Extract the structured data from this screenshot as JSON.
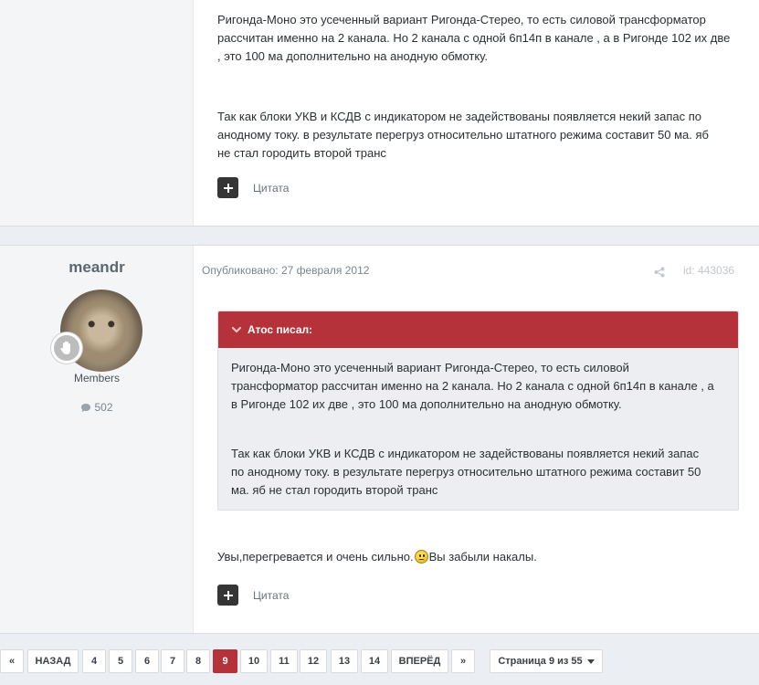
{
  "post1": {
    "paragraph1": "Ригонда-Моно это усеченный вариант Ригонда-Стерео, то есть силовой трансформатор\nрассчитан именно на 2 канала. Но 2 канала с одной 6п14п в канале , а в Ригонде 102 их две\n, это 100 ма дополнительно на анодную обмотку.",
    "paragraph2": "Так как блоки УКВ и КСДВ с индикатором не задействованы появляется некий запас по\nанодному току. в результате перегруз относительно штатного режима составит 50 ма. яб\nне стал городить второй транс",
    "quote_label": "Цитата"
  },
  "post2": {
    "author": "meandr",
    "group": "Members",
    "post_count": "502",
    "published": "Опубликовано: 27 февраля 2012",
    "post_id": "id: 443036",
    "quote": {
      "header": "Атос писал:",
      "paragraph1": "Ригонда-Моно это усеченный вариант Ригонда-Стерео, то есть силовой\nтрансформатор рассчитан именно на 2 канала. Но 2 канала с одной 6п14п в канале , а\nв Ригонде 102 их две , это 100 ма дополнительно на анодную обмотку.",
      "paragraph2": "Так как блоки УКВ и КСДВ с индикатором не задействованы появляется некий запас\nпо анодному току. в результате перегруз относительно штатного режима составит 50\nма. яб не стал городить второй транс"
    },
    "reply_before": "Увы,перегревается и очень сильно.",
    "reply_after": "Вы забыли накалы.",
    "quote_label": "Цитата"
  },
  "pagination": {
    "first": "«",
    "prev": "НАЗАД",
    "pages": [
      "4",
      "5",
      "6",
      "7",
      "8",
      "9",
      "10",
      "11",
      "12",
      "13",
      "14"
    ],
    "current": "9",
    "next": "ВПЕРЁД",
    "last": "»",
    "page_label": "Страница 9 из 55"
  },
  "colors": {
    "accent": "#b5323b",
    "background": "#ebeef2"
  }
}
